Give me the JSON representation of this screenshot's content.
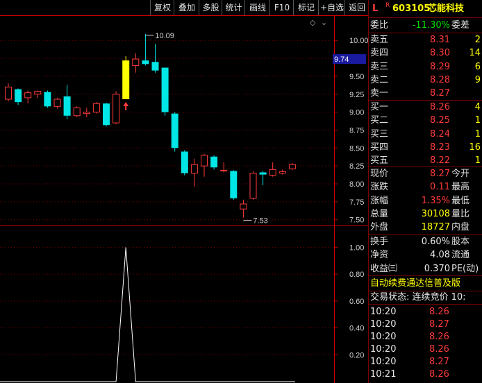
{
  "toolbar": {
    "buttons": [
      "复权",
      "叠加",
      "多股",
      "统计",
      "画线",
      "F10",
      "标记",
      "+自选",
      "返回"
    ]
  },
  "stock": {
    "prefix": "L",
    "r_mark": "R",
    "code": "603105",
    "name": "芯能科技"
  },
  "order_ratio": {
    "label": "委比",
    "value": "-11.30%",
    "label2": "委差"
  },
  "asks": [
    {
      "label": "卖五",
      "price": "8.31",
      "vol": "2"
    },
    {
      "label": "卖四",
      "price": "8.30",
      "vol": "14"
    },
    {
      "label": "卖三",
      "price": "8.29",
      "vol": "6"
    },
    {
      "label": "卖二",
      "price": "8.28",
      "vol": "9"
    },
    {
      "label": "卖一",
      "price": "8.27",
      "vol": ""
    }
  ],
  "bids": [
    {
      "label": "买一",
      "price": "8.26",
      "vol": "4"
    },
    {
      "label": "买二",
      "price": "8.25",
      "vol": "1"
    },
    {
      "label": "买三",
      "price": "8.24",
      "vol": "1"
    },
    {
      "label": "买四",
      "price": "8.23",
      "vol": "16"
    },
    {
      "label": "买五",
      "price": "8.22",
      "vol": "1"
    }
  ],
  "quote": [
    {
      "label": "现价",
      "value": "8.27",
      "label2": "今开"
    },
    {
      "label": "涨跌",
      "value": "0.11",
      "label2": "最高"
    },
    {
      "label": "涨幅",
      "value": "1.35%",
      "label2": "最低"
    },
    {
      "label": "总量",
      "value": "30108",
      "label2": "量比"
    },
    {
      "label": "外盘",
      "value": "18727",
      "label2": "内盘"
    }
  ],
  "quote2": [
    {
      "label": "换手",
      "value": "0.60%",
      "label2": "股本"
    },
    {
      "label": "净资",
      "value": "4.08",
      "label2": "流通"
    },
    {
      "label": "收益㈢",
      "value": "0.370",
      "label2": "PE(动)"
    }
  ],
  "banner": "自动续费通达信普及版",
  "trade_status": "交易状态: 连续竞价 10:",
  "ticks": [
    {
      "time": "10:20",
      "price": "8.26"
    },
    {
      "time": "10:20",
      "price": "8.27"
    },
    {
      "time": "10:20",
      "price": "8.26"
    },
    {
      "time": "10:20",
      "price": "8.26"
    },
    {
      "time": "10:20",
      "price": "8.27"
    },
    {
      "time": "10:21",
      "price": "8.26"
    }
  ],
  "chart_data": {
    "type": "candlestick",
    "price_axis": {
      "ticks": [
        "10.00",
        "9.75",
        "9.50",
        "9.25",
        "9.00",
        "8.75",
        "8.50",
        "8.25",
        "8.00",
        "7.75",
        "7.50"
      ],
      "range": [
        7.42,
        10.35
      ],
      "current": "9.74"
    },
    "annotations": {
      "high": "10.09",
      "low": "7.53"
    },
    "indicator_axis": {
      "ticks": [
        "1.00",
        "0.80",
        "0.60",
        "0.40",
        "0.20"
      ],
      "range": [
        0,
        1.1
      ]
    },
    "candles": [
      {
        "o": 9.18,
        "h": 9.4,
        "l": 9.15,
        "c": 9.35,
        "dir": "up"
      },
      {
        "o": 9.32,
        "h": 9.33,
        "l": 9.1,
        "c": 9.14,
        "dir": "down"
      },
      {
        "o": 9.2,
        "h": 9.3,
        "l": 9.12,
        "c": 9.27,
        "dir": "up"
      },
      {
        "o": 9.25,
        "h": 9.3,
        "l": 9.2,
        "c": 9.29,
        "dir": "up"
      },
      {
        "o": 9.28,
        "h": 9.3,
        "l": 9.06,
        "c": 9.08,
        "dir": "down"
      },
      {
        "o": 9.08,
        "h": 9.2,
        "l": 9.05,
        "c": 9.18,
        "dir": "up"
      },
      {
        "o": 9.22,
        "h": 9.38,
        "l": 8.9,
        "c": 8.95,
        "dir": "down"
      },
      {
        "o": 8.95,
        "h": 9.08,
        "l": 8.93,
        "c": 9.06,
        "dir": "up"
      },
      {
        "o": 8.98,
        "h": 9.06,
        "l": 8.93,
        "c": 9.0,
        "dir": "up"
      },
      {
        "o": 9.0,
        "h": 9.14,
        "l": 8.98,
        "c": 9.12,
        "dir": "up"
      },
      {
        "o": 9.12,
        "h": 9.13,
        "l": 8.8,
        "c": 8.82,
        "dir": "down"
      },
      {
        "o": 8.85,
        "h": 9.29,
        "l": 8.83,
        "c": 9.25,
        "dir": "up"
      },
      {
        "o": 9.18,
        "h": 9.78,
        "l": 9.18,
        "c": 9.72,
        "dir": "up",
        "highlight": true
      },
      {
        "o": 9.65,
        "h": 9.82,
        "l": 9.55,
        "c": 9.74,
        "dir": "up"
      },
      {
        "o": 9.72,
        "h": 10.09,
        "l": 9.65,
        "c": 9.67,
        "dir": "down"
      },
      {
        "o": 9.7,
        "h": 9.95,
        "l": 9.55,
        "c": 9.58,
        "dir": "down"
      },
      {
        "o": 9.62,
        "h": 9.62,
        "l": 8.95,
        "c": 9.0,
        "dir": "down"
      },
      {
        "o": 8.98,
        "h": 9.0,
        "l": 8.45,
        "c": 8.5,
        "dir": "down"
      },
      {
        "o": 8.45,
        "h": 8.47,
        "l": 8.12,
        "c": 8.15,
        "dir": "down"
      },
      {
        "o": 8.15,
        "h": 8.35,
        "l": 7.96,
        "c": 8.27,
        "dir": "up"
      },
      {
        "o": 8.25,
        "h": 8.42,
        "l": 8.1,
        "c": 8.4,
        "dir": "up"
      },
      {
        "o": 8.38,
        "h": 8.4,
        "l": 8.2,
        "c": 8.23,
        "dir": "down"
      },
      {
        "o": 8.18,
        "h": 8.3,
        "l": 8.16,
        "c": 8.19,
        "dir": "up"
      },
      {
        "o": 8.18,
        "h": 8.19,
        "l": 7.78,
        "c": 7.8,
        "dir": "down"
      },
      {
        "o": 7.65,
        "h": 7.78,
        "l": 7.53,
        "c": 7.72,
        "dir": "up"
      },
      {
        "o": 7.8,
        "h": 8.18,
        "l": 7.78,
        "c": 8.15,
        "dir": "up"
      },
      {
        "o": 8.13,
        "h": 8.18,
        "l": 7.98,
        "c": 8.16,
        "dir": "down"
      },
      {
        "o": 8.12,
        "h": 8.3,
        "l": 8.1,
        "c": 8.2,
        "dir": "up"
      },
      {
        "o": 8.15,
        "h": 8.2,
        "l": 8.13,
        "c": 8.17,
        "dir": "up"
      },
      {
        "o": 8.21,
        "h": 8.29,
        "l": 8.19,
        "c": 8.27,
        "dir": "up"
      }
    ],
    "indicator": [
      0,
      0,
      0,
      0,
      0,
      0,
      0,
      0,
      0,
      0,
      0,
      0,
      1.0,
      0,
      0,
      0,
      0,
      0,
      0,
      0,
      0,
      0,
      0,
      0,
      0,
      0,
      0,
      0,
      0,
      0
    ],
    "colors": {
      "up": "#ff3b3b",
      "down": "#00e5e5",
      "highlight": "#ffff00",
      "grid": "#7a0000",
      "axis": "#cc0000",
      "text": "#d0d0d0"
    }
  }
}
